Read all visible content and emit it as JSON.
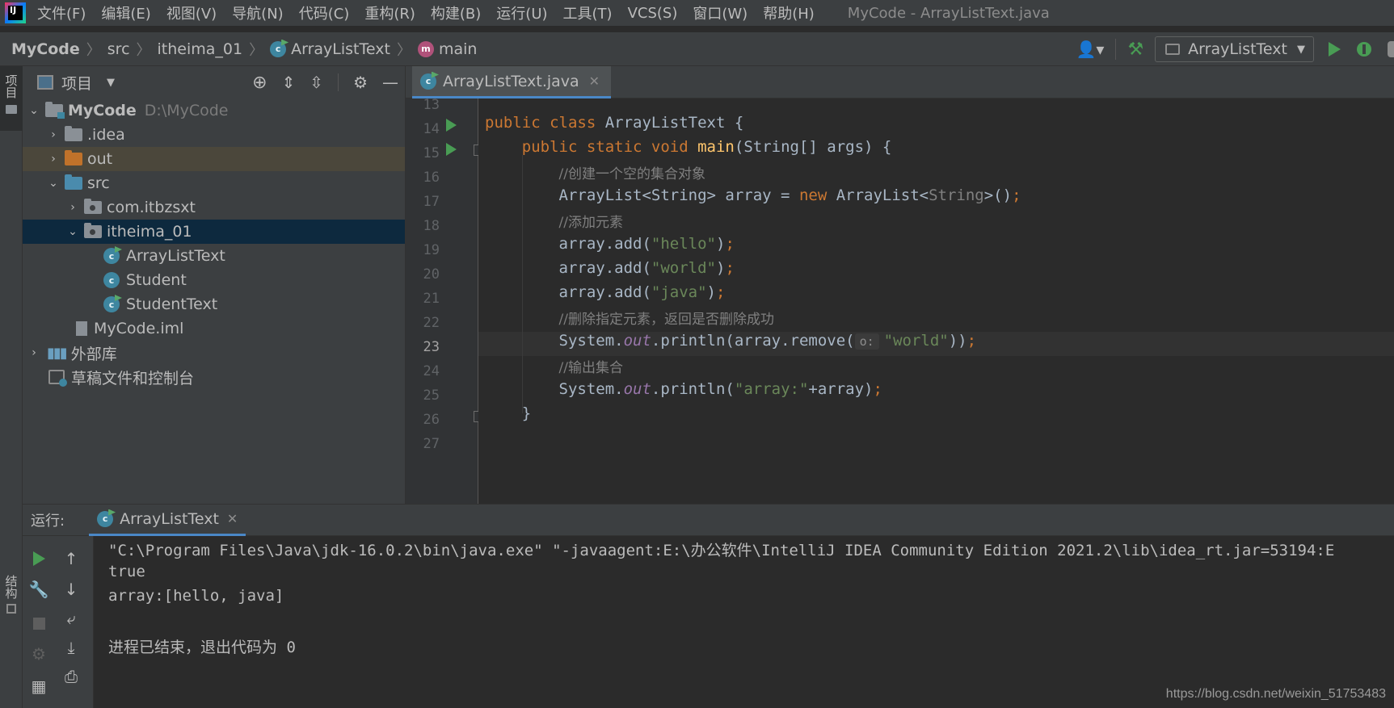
{
  "menu": {
    "items": [
      "文件(F)",
      "编辑(E)",
      "视图(V)",
      "导航(N)",
      "代码(C)",
      "重构(R)",
      "构建(B)",
      "运行(U)",
      "工具(T)",
      "VCS(S)",
      "窗口(W)",
      "帮助(H)"
    ],
    "window_title": "MyCode - ArrayListText.java"
  },
  "breadcrumb": {
    "items": [
      "MyCode",
      "src",
      "itheima_01",
      "ArrayListText",
      "main"
    ]
  },
  "toolbar": {
    "run_config": "ArrayListText"
  },
  "left_strip": {
    "project_tab": "项目",
    "structure_tab": "结构"
  },
  "project_panel": {
    "title": "项目",
    "tree": {
      "root": "MyCode",
      "root_path": "D:\\MyCode",
      "idea": ".idea",
      "out": "out",
      "src": "src",
      "pkg1": "com.itbzsxt",
      "pkg2": "itheima_01",
      "class1": "ArrayListText",
      "class2": "Student",
      "class3": "StudentText",
      "iml": "MyCode.iml",
      "ext_libs": "外部库",
      "scratches": "草稿文件和控制台"
    }
  },
  "editor": {
    "tab_label": "ArrayListText.java",
    "line_numbers": [
      "13",
      "14",
      "15",
      "16",
      "17",
      "18",
      "19",
      "20",
      "21",
      "22",
      "23",
      "24",
      "25",
      "26",
      "27"
    ],
    "current_line": "23",
    "param_hint": "o:"
  },
  "run_panel": {
    "label": "运行:",
    "tab_label": "ArrayListText",
    "console_lines": [
      "\"C:\\Program Files\\Java\\jdk-16.0.2\\bin\\java.exe\" \"-javaagent:E:\\办公软件\\IntelliJ IDEA Community Edition 2021.2\\lib\\idea_rt.jar=53194:E",
      "true",
      "array:[hello, java]",
      "",
      "进程已结束，退出代码为 0"
    ]
  },
  "watermark": "https://blog.csdn.net/weixin_51753483",
  "colors": {
    "background": "#2b2b2b",
    "panel": "#3c3f41",
    "keyword": "#cc7832",
    "string": "#6a8759",
    "comment": "#808080",
    "selection": "#0d293e",
    "accent": "#4a88c7"
  }
}
